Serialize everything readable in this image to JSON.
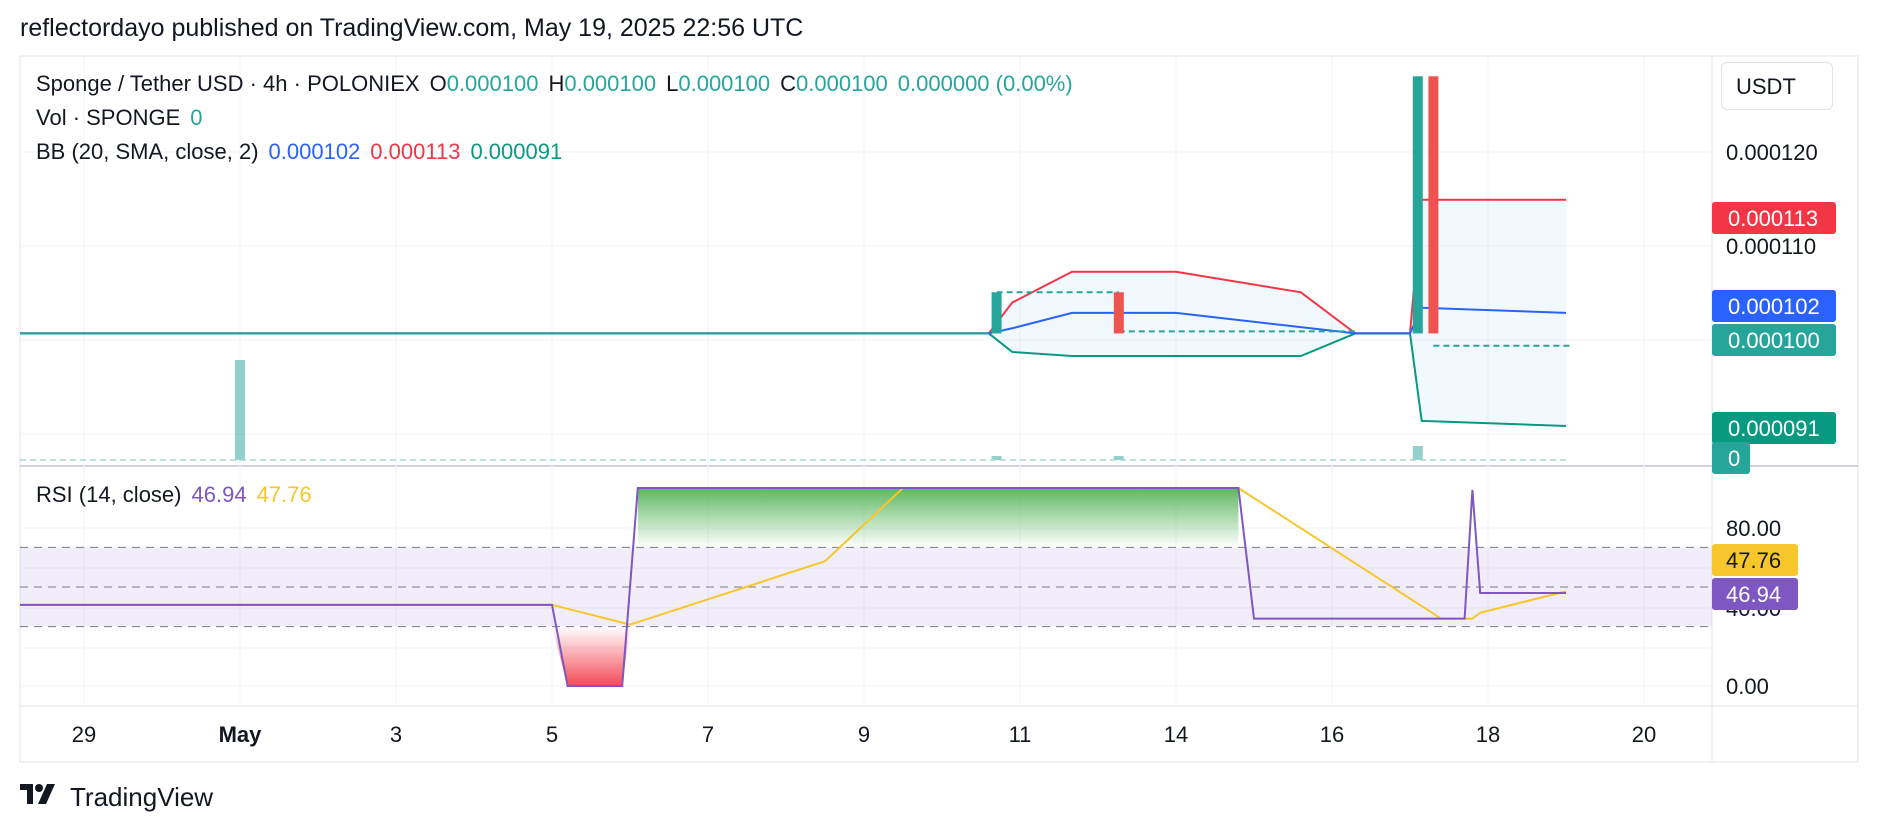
{
  "header": {
    "published": "reflectordayo published on TradingView.com, May 19, 2025 22:56 UTC"
  },
  "legend": {
    "symbol": "Sponge / Tether USD · 4h · POLONIEX",
    "o_label": "O",
    "o_value": "0.000100",
    "h_label": "H",
    "h_value": "0.000100",
    "l_label": "L",
    "l_value": "0.000100",
    "c_label": "C",
    "c_value": "0.000100",
    "change": "0.000000 (0.00%)",
    "vol_label": "Vol · SPONGE",
    "vol_value": "0",
    "bb_label": "BB (20, SMA, close, 2)",
    "bb_basis": "0.000102",
    "bb_upper": "0.000113",
    "bb_lower": "0.000091",
    "rsi_label": "RSI (14, close)",
    "rsi_value": "46.94",
    "rsi_ma": "47.76"
  },
  "price_axis": {
    "currency": "USDT",
    "ticks": [
      "0.000120",
      "0.000110"
    ]
  },
  "price_badges": [
    {
      "text": "0.000113",
      "color": "#f23645"
    },
    {
      "text": "0.000102",
      "color": "#2962ff"
    },
    {
      "text": "0.000100",
      "color": "#26a69a"
    },
    {
      "text": "0.000091",
      "color": "#089981"
    },
    {
      "text": "0",
      "color": "#26a69a"
    }
  ],
  "rsi_axis": {
    "ticks": [
      "80.00",
      "40.00",
      "0.00"
    ]
  },
  "rsi_badges": [
    {
      "text": "47.76",
      "color": "#f7c62b",
      "textcolor": "#131722"
    },
    {
      "text": "46.94",
      "color": "#7e57c2",
      "textcolor": "#ffffff"
    }
  ],
  "time_axis": [
    "29",
    "May",
    "3",
    "5",
    "7",
    "9",
    "11",
    "14",
    "16",
    "18",
    "20"
  ],
  "brand": {
    "name": "TradingView"
  },
  "chart_data": {
    "type": "candlestick",
    "x_labels": [
      "29",
      "May",
      "3",
      "5",
      "7",
      "9",
      "11",
      "14",
      "16",
      "18",
      "20"
    ],
    "price_range": [
      8.75e-05,
      0.000126
    ],
    "candles": [
      {
        "x": 10.7,
        "o": 0.0001,
        "h": 0.000104,
        "l": 0.0001,
        "c": 0.000104,
        "dir": "up"
      },
      {
        "x": 12.9,
        "o": 0.000104,
        "h": 0.000104,
        "l": 0.0001,
        "c": 0.0001,
        "dir": "down"
      },
      {
        "x": 17.1,
        "o": 0.0001,
        "h": 0.000125,
        "l": 0.0001,
        "c": 0.000125,
        "dir": "up"
      },
      {
        "x": 17.3,
        "o": 0.000125,
        "h": 0.000125,
        "l": 0.0001,
        "c": 0.0001,
        "dir": "down"
      }
    ],
    "flat_price": 0.0001,
    "bollinger": {
      "upper": [
        [
          0,
          0.0001
        ],
        [
          10.6,
          0.0001
        ],
        [
          10.9,
          0.000103
        ],
        [
          12.0,
          0.000106
        ],
        [
          14.0,
          0.000106
        ],
        [
          15.6,
          0.000104
        ],
        [
          16.3,
          0.0001
        ],
        [
          17.0,
          0.0001
        ],
        [
          17.15,
          0.000113
        ],
        [
          19.0,
          0.000113
        ]
      ],
      "basis": [
        [
          0,
          0.0001
        ],
        [
          10.6,
          0.0001
        ],
        [
          10.9,
          0.0001005
        ],
        [
          12.0,
          0.000102
        ],
        [
          14.0,
          0.000102
        ],
        [
          16.3,
          0.0001
        ],
        [
          17.0,
          0.0001
        ],
        [
          17.15,
          0.0001025
        ],
        [
          19.0,
          0.000102
        ]
      ],
      "lower": [
        [
          0,
          0.0001
        ],
        [
          10.6,
          0.0001
        ],
        [
          10.9,
          9.82e-05
        ],
        [
          12.0,
          9.78e-05
        ],
        [
          14.0,
          9.78e-05
        ],
        [
          15.6,
          9.78e-05
        ],
        [
          16.3,
          0.0001
        ],
        [
          17.0,
          0.0001
        ],
        [
          17.15,
          9.15e-05
        ],
        [
          19.0,
          9.1e-05
        ]
      ]
    },
    "volume": [
      {
        "x": 1.0,
        "v": 1.0
      },
      {
        "x": 10.7,
        "v": 0.04
      },
      {
        "x": 12.9,
        "v": 0.04
      },
      {
        "x": 17.1,
        "v": 0.14
      }
    ],
    "rsi": {
      "range": [
        0,
        100
      ],
      "upper_band": 70,
      "mid": 50,
      "lower_band": 30,
      "rsi_line": [
        [
          0,
          41
        ],
        [
          5.0,
          41
        ],
        [
          5.2,
          0
        ],
        [
          5.9,
          0
        ],
        [
          6.1,
          100
        ],
        [
          14.8,
          100
        ],
        [
          15.0,
          34
        ],
        [
          17.6,
          34
        ],
        [
          17.7,
          34
        ],
        [
          17.8,
          99
        ],
        [
          17.9,
          47
        ],
        [
          19.0,
          47
        ]
      ],
      "ma_line": [
        [
          0,
          41
        ],
        [
          5.0,
          41
        ],
        [
          6.0,
          31
        ],
        [
          8.5,
          63
        ],
        [
          9.5,
          100
        ],
        [
          14.8,
          100
        ],
        [
          17.4,
          34
        ],
        [
          17.8,
          34
        ],
        [
          17.9,
          37
        ],
        [
          19.0,
          47.8
        ]
      ]
    }
  }
}
